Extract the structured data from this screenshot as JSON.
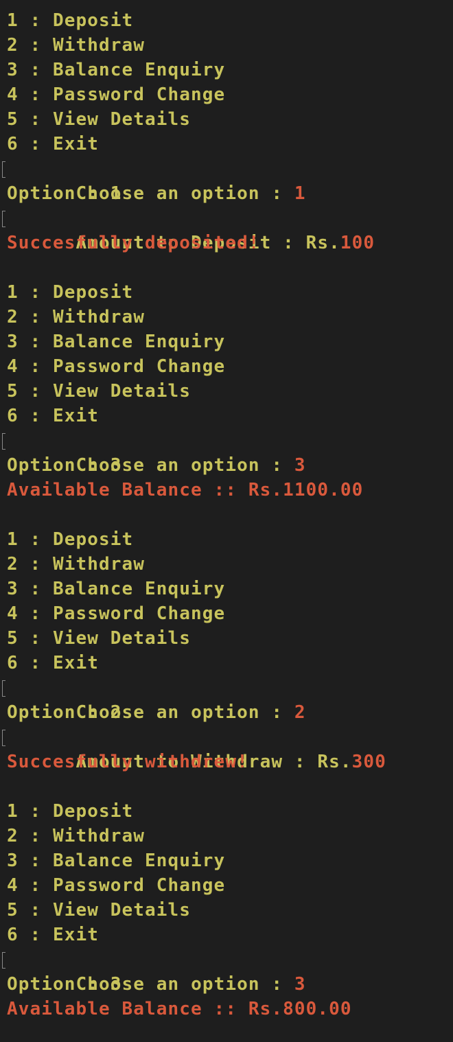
{
  "colors": {
    "background": "#1e1e1e",
    "text_yellow": "#c8c35c",
    "text_red": "#d9593c"
  },
  "blocks": [
    {
      "menu": [
        "1 : Deposit",
        "2 : Withdraw",
        "3 : Balance Enquiry",
        "4 : Password Change",
        "5 : View Details",
        "6 : Exit"
      ],
      "prompt": "Choose an option : ",
      "choice": "1",
      "echo": "Option : 1",
      "amount_prompt": "Amount to Deposit : Rs.",
      "amount_value": "100",
      "result": "Succesfully deposited!"
    },
    {
      "menu": [
        "1 : Deposit",
        "2 : Withdraw",
        "3 : Balance Enquiry",
        "4 : Password Change",
        "5 : View Details",
        "6 : Exit"
      ],
      "prompt": "Choose an option : ",
      "choice": "3",
      "echo": "Option : 3",
      "result": "Available Balance :: Rs.1100.00"
    },
    {
      "menu": [
        "1 : Deposit",
        "2 : Withdraw",
        "3 : Balance Enquiry",
        "4 : Password Change",
        "5 : View Details",
        "6 : Exit"
      ],
      "prompt": "Choose an option : ",
      "choice": "2",
      "echo": "Option : 2",
      "amount_prompt": "Amount to Withdraw : Rs.",
      "amount_value": "300",
      "result": "Succesfully withdrew!"
    },
    {
      "menu": [
        "1 : Deposit",
        "2 : Withdraw",
        "3 : Balance Enquiry",
        "4 : Password Change",
        "5 : View Details",
        "6 : Exit"
      ],
      "prompt": "Choose an option : ",
      "choice": "3",
      "echo": "Option : 3",
      "result": "Available Balance :: Rs.800.00"
    }
  ]
}
